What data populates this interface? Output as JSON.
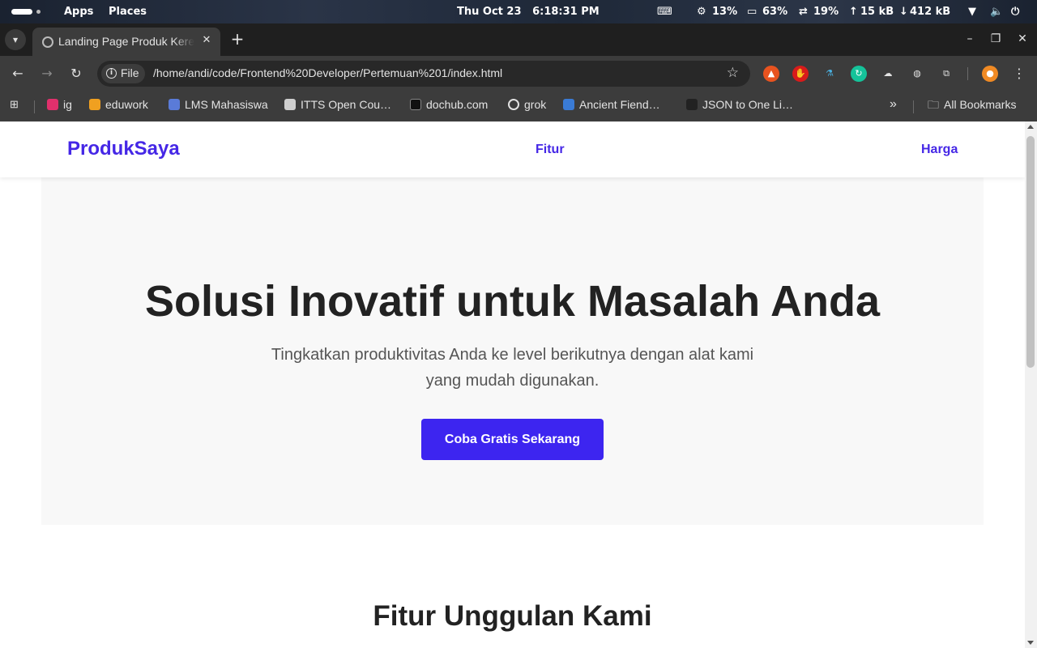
{
  "topbar": {
    "apps_label": "Apps",
    "places_label": "Places",
    "datetime": "Thu Oct 23   6:18:31 PM",
    "cpu": "13%",
    "memory": "63%",
    "swap": "19%",
    "upload": "15 kB",
    "download": "412 kB",
    "icons": [
      "activities-icon",
      "keyboard-layout-icon",
      "cpu-icon",
      "memory-icon",
      "swap-icon",
      "upload-arrow-icon",
      "download-arrow-icon",
      "wifi-icon",
      "volume-icon",
      "power-icon"
    ]
  },
  "browser": {
    "tab": {
      "title": "Landing Page Produk Keren",
      "close_glyph": "✕"
    },
    "new_tab_glyph": "+",
    "window_controls": {
      "minimize": "–",
      "maximize": "❐",
      "close": "✕"
    },
    "address": {
      "scheme_label": "File",
      "url": "/home/andi/code/Frontend%20Developer/Pertemuan%201/index.html"
    },
    "bookmarks": [
      {
        "label": "ig",
        "color": "#e1306c"
      },
      {
        "label": "eduwork",
        "color": "#f0a020"
      },
      {
        "label": "LMS Mahasiswa",
        "color": "#5a7bd8"
      },
      {
        "label": "ITTS Open Cou…",
        "color": "#cfcfcf"
      },
      {
        "label": "dochub.com",
        "color": "#111111"
      },
      {
        "label": "grok",
        "color": "#e3e3e3"
      },
      {
        "label": "Ancient Fiend…",
        "color": "#3a7bd5"
      },
      {
        "label": "JSON to One Li…",
        "color": "#222222"
      }
    ],
    "bookmarks_overflow": "»",
    "all_bookmarks_label": "All Bookmarks"
  },
  "site": {
    "brand": "ProdukSaya",
    "nav": {
      "features": "Fitur",
      "pricing": "Harga"
    },
    "hero": {
      "title": "Solusi Inovatif untuk Masalah Anda",
      "subtitle": "Tingkatkan produktivitas Anda ke level berikutnya dengan alat kami yang mudah digunakan.",
      "cta": "Coba Gratis Sekarang"
    },
    "features_heading": "Fitur Unggulan Kami"
  },
  "colors": {
    "brand_accent": "#4527e6",
    "cta_bg": "#3d25f0",
    "hero_bg": "#f8f8f8"
  }
}
